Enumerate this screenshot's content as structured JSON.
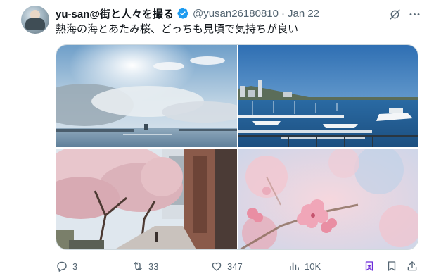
{
  "tweet": {
    "author_name": "yu-san@街と人々を撮る",
    "handle": "@yusan26180810",
    "separator": "·",
    "date": "Jan 22",
    "text": "熱海の海とあたみ桜、どっちも見頃で気持ちが良い",
    "verified": true
  },
  "media": {
    "images": [
      {
        "subject": "sea-horizon-sunlit-clouds"
      },
      {
        "subject": "marina-with-boats"
      },
      {
        "subject": "cherry-blossom-street"
      },
      {
        "subject": "pink-cherry-blossom-closeup"
      }
    ]
  },
  "actions": {
    "replies": "3",
    "reposts": "33",
    "likes": "347",
    "views": "10K"
  },
  "colors": {
    "text": "#0f1419",
    "secondary": "#536471",
    "verified_blue": "#1d9bf0",
    "bookmark_purple": "#6c2bd9",
    "border": "#cfd9de"
  },
  "icons": [
    "verified-badge-icon",
    "grok-icon",
    "more-icon",
    "reply-icon",
    "repost-icon",
    "like-icon",
    "views-icon",
    "bookmark-icon",
    "share-icon"
  ]
}
